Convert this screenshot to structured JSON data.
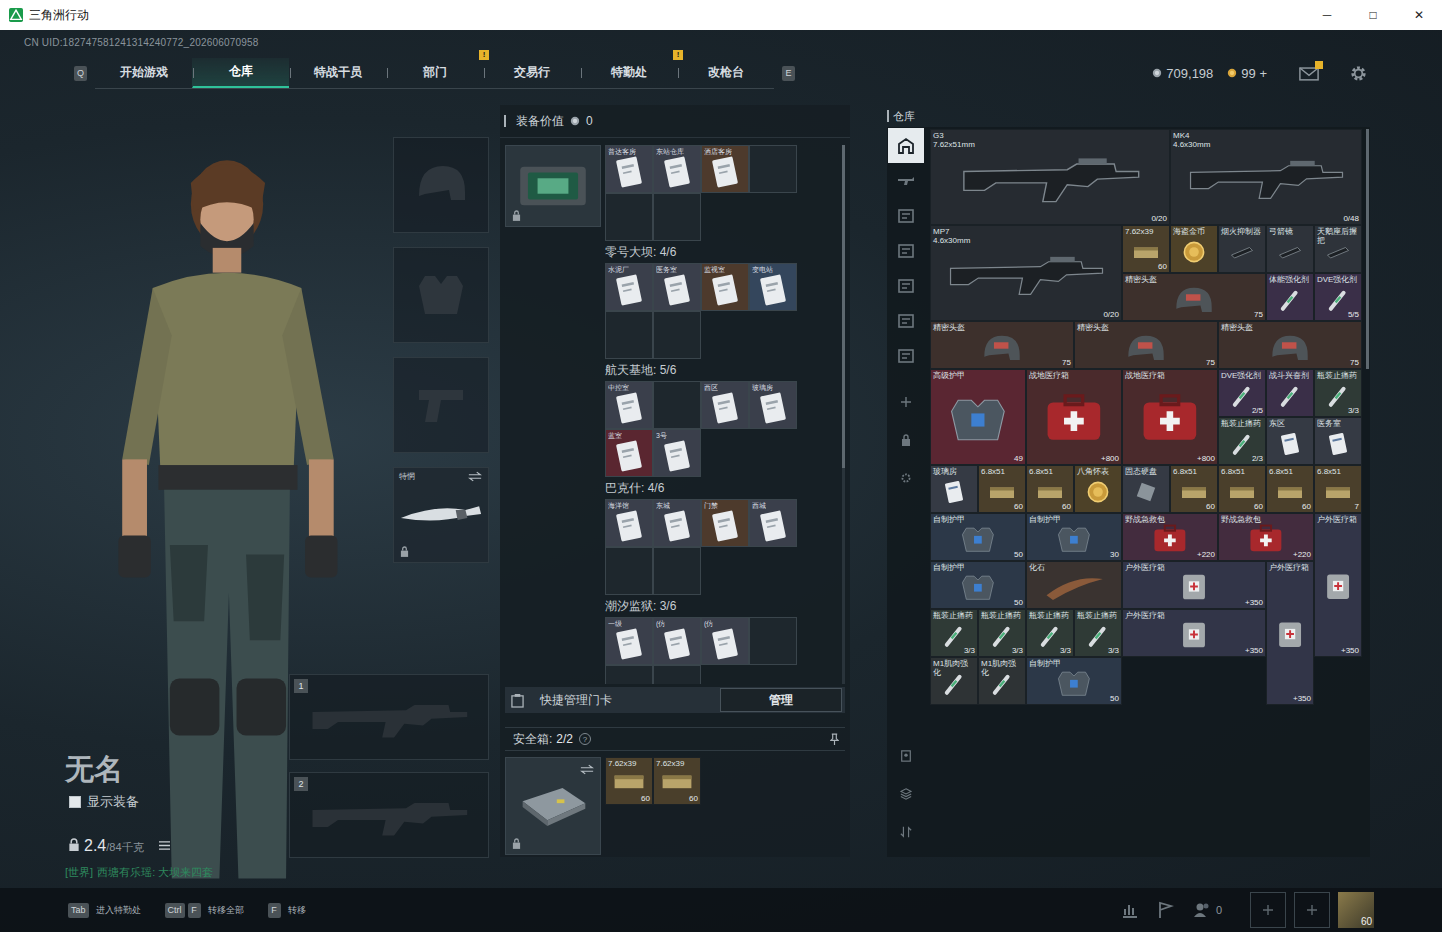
{
  "window": {
    "title": "三角洲行动",
    "controls": [
      "─",
      "□",
      "✕"
    ]
  },
  "uid": "CN UID:182747581241314240772_202606070958",
  "nav": {
    "prev_key": "Q",
    "next_key": "E",
    "alert_mark": "!",
    "tabs": [
      {
        "label": "开始游戏",
        "selected": false,
        "alert": false
      },
      {
        "label": "仓库",
        "selected": true,
        "alert": false
      },
      {
        "label": "特战干员",
        "selected": false,
        "alert": false
      },
      {
        "label": "部门",
        "selected": false,
        "alert": false
      },
      {
        "label": "交易行",
        "selected": false,
        "alert": true
      },
      {
        "label": "特勤处",
        "selected": false,
        "alert": false
      },
      {
        "label": "改枪台",
        "selected": false,
        "alert": true
      }
    ]
  },
  "currency": [
    {
      "kind": "silver",
      "amount": "709,198"
    },
    {
      "kind": "gold",
      "amount": "99 +"
    }
  ],
  "mail": {
    "alert": true
  },
  "character": {
    "name": "无名",
    "show_equipment": {
      "label": "显示装备",
      "checked": false
    },
    "weight": "2.4",
    "capacity": "/84千克",
    "chat": {
      "channel": "[世界]",
      "text": "西塘有乐瑶: 大坝来四套"
    }
  },
  "equipment": {
    "slots": [
      {
        "kind": "helmet",
        "filled": false
      },
      {
        "kind": "armor",
        "filled": false
      },
      {
        "kind": "pistol",
        "filled": false
      },
      {
        "kind": "knife",
        "filled": true,
        "label": "特惘",
        "locked": true
      }
    ],
    "weapons": [
      {
        "number": "1",
        "filled": false
      },
      {
        "number": "2",
        "filled": false
      }
    ]
  },
  "loadout": {
    "value_label": "装备价值",
    "value": "0",
    "keycards": {
      "locked": true,
      "groups": [
        {
          "slots": [
            {
              "filled": true,
              "label": "普达客房",
              "color": "#3a3f4b"
            },
            {
              "filled": true,
              "label": "东站仓库",
              "color": "#3a3f4b"
            },
            {
              "filled": true,
              "label": "酒店客房",
              "color": "#4d3a2c"
            },
            {
              "filled": false
            },
            {
              "filled": false
            },
            {
              "filled": false
            }
          ]
        },
        {
          "title": "零号大坝: 4/6",
          "slots": [
            {
              "filled": true,
              "label": "水泥厂",
              "color": "#3a3f4b"
            },
            {
              "filled": true,
              "label": "医务室",
              "color": "#3a3f4b"
            },
            {
              "filled": true,
              "label": "监视室",
              "color": "#4d3a2c"
            },
            {
              "filled": true,
              "label": "变电站",
              "color": "#34465c"
            },
            {
              "filled": false
            },
            {
              "filled": false
            }
          ]
        },
        {
          "title": "航天基地: 5/6",
          "slots": [
            {
              "filled": true,
              "label": "中控室",
              "color": "#3a3f4b"
            },
            {
              "filled": false
            },
            {
              "filled": true,
              "label": "西区",
              "color": "#3a3f4b"
            },
            {
              "filled": true,
              "label": "玻璃房",
              "color": "#3a3f4b"
            },
            {
              "filled": true,
              "label": "蓝室",
              "color": "#5a2630"
            },
            {
              "filled": true,
              "label": "3号",
              "color": "#3a3f4b"
            }
          ]
        },
        {
          "title": "巴克什: 4/6",
          "slots": [
            {
              "filled": true,
              "label": "海洋馆",
              "color": "#3a3f4b"
            },
            {
              "filled": true,
              "label": "东城",
              "color": "#3a3f4b"
            },
            {
              "filled": true,
              "label": "门禁",
              "color": "#4d3a2c"
            },
            {
              "filled": true,
              "label": "西城",
              "color": "#3a3f4b"
            },
            {
              "filled": false
            },
            {
              "filled": false
            }
          ]
        },
        {
          "title": "潮汐监狱: 3/6",
          "slots": [
            {
              "filled": true,
              "label": "一级",
              "color": "#3a3f4b"
            },
            {
              "filled": true,
              "label": "(仿",
              "color": "#3a3f4b"
            },
            {
              "filled": true,
              "label": "(仿",
              "color": "#3a3f4b"
            },
            {
              "filled": false
            },
            {
              "filled": false
            },
            {
              "filled": false
            }
          ]
        }
      ]
    },
    "quick_manage": {
      "label": "快捷管理门卡",
      "button": "管理"
    },
    "safebox": {
      "label": "安全箱:",
      "count": "2/2",
      "help": "?",
      "locked": true,
      "items": [
        {
          "name": "7.62x39",
          "count": "60"
        },
        {
          "name": "7.62x39",
          "count": "60"
        }
      ]
    }
  },
  "warehouse": {
    "title": "仓库",
    "sidebar": [
      {
        "kind": "all",
        "selected": true
      },
      {
        "kind": "rifle",
        "selected": false
      },
      {
        "kind": "box",
        "selected": false
      },
      {
        "kind": "box",
        "selected": false
      },
      {
        "kind": "box",
        "selected": false
      },
      {
        "kind": "box",
        "selected": false
      },
      {
        "kind": "box",
        "selected": false
      }
    ],
    "tools": [
      {
        "kind": "add"
      },
      {
        "kind": "lock"
      },
      {
        "kind": "gear"
      }
    ],
    "bottom_tools": [
      {
        "kind": "vendor"
      },
      {
        "kind": "layers"
      },
      {
        "kind": "sort"
      }
    ],
    "items": [
      {
        "kind": "weapon",
        "name": "G3",
        "sub": "7.62x51mm",
        "count": "0/20",
        "color": "#262b31"
      },
      {
        "kind": "weapon",
        "name": "MK4",
        "sub": "4.6x30mm",
        "count": "0/48",
        "color": "#262b31"
      },
      {
        "kind": "weapon",
        "name": "MP7",
        "sub": "4.6x30mm",
        "count": "0/20",
        "color": "#262b31"
      },
      {
        "kind": "ammo",
        "name": "7.62x39",
        "count": "60",
        "color": "#4a3f2b"
      },
      {
        "kind": "coin",
        "name": "海盗金币",
        "color": "#4d4128"
      },
      {
        "kind": "attach",
        "name": "烟火抑制器",
        "color": "#2e333a"
      },
      {
        "kind": "attach",
        "name": "弓箭镜",
        "color": "#2e333a"
      },
      {
        "kind": "attach",
        "name": "天鹅座后握把",
        "color": "#2e333a"
      },
      {
        "kind": "helmet",
        "name": "精密头盔",
        "count": "75",
        "color": "#3d302c"
      },
      {
        "kind": "vial",
        "name": "体能强化剂",
        "color": "#3a2f48"
      },
      {
        "kind": "vial",
        "name": "DVE强化剂",
        "count": "5/5",
        "color": "#3a2f48"
      },
      {
        "kind": "helmet",
        "name": "精密头盔",
        "count": "75",
        "color": "#3d302c"
      },
      {
        "kind": "helmet",
        "name": "精密头盔",
        "count": "75",
        "color": "#3d302c"
      },
      {
        "kind": "helmet",
        "name": "精密头盔",
        "count": "75",
        "color": "#3d302c"
      },
      {
        "kind": "armor",
        "name": "高级护甲",
        "count": "49",
        "color": "#5a2632"
      },
      {
        "kind": "medkit",
        "name": "战地医疗箱",
        "count": "+800",
        "color": "#4a2a2c"
      },
      {
        "kind": "medkit",
        "name": "战地医疗箱",
        "count": "+800",
        "color": "#4a2a2c"
      },
      {
        "kind": "vial",
        "name": "DVE强化剂",
        "count": "2/5",
        "color": "#3a2f48"
      },
      {
        "kind": "vial",
        "name": "战斗兴奋剂",
        "color": "#3a2f48"
      },
      {
        "kind": "vial",
        "name": "瓶装止痛药",
        "count": "3/3",
        "color": "#2f3a36"
      },
      {
        "kind": "vial",
        "name": "瓶装止痛药",
        "count": "2/3",
        "color": "#2f3a36"
      },
      {
        "kind": "card",
        "name": "东区",
        "color": "#353a44"
      },
      {
        "kind": "card",
        "name": "医务室",
        "color": "#353a44"
      },
      {
        "kind": "card",
        "name": "玻璃房",
        "color": "#353a44"
      },
      {
        "kind": "ammo",
        "name": "6.8x51",
        "count": "60",
        "color": "#4a3f2b"
      },
      {
        "kind": "ammo",
        "name": "6.8x51",
        "count": "60",
        "color": "#4a3f2b"
      },
      {
        "kind": "coin",
        "name": "八角怀表",
        "color": "#4d4128"
      },
      {
        "kind": "drive",
        "name": "固态硬盘",
        "color": "#353a44"
      },
      {
        "kind": "ammo",
        "name": "6.8x51",
        "count": "60",
        "color": "#4a3f2b"
      },
      {
        "kind": "ammo",
        "name": "6.8x51",
        "count": "60",
        "color": "#4a3f2b"
      },
      {
        "kind": "ammo",
        "name": "6.8x51",
        "count": "60",
        "color": "#4a3f2b"
      },
      {
        "kind": "ammo",
        "name": "6.8x51",
        "count": "7",
        "color": "#4a3f2b"
      },
      {
        "kind": "armor",
        "name": "自制护甲",
        "count": "50",
        "color": "#2c3848"
      },
      {
        "kind": "armor",
        "name": "自制护甲",
        "count": "30",
        "color": "#2c3848"
      },
      {
        "kind": "medkit",
        "name": "野战急救包",
        "count": "+220",
        "color": "#432c3e"
      },
      {
        "kind": "medkit",
        "name": "野战急救包",
        "count": "+220",
        "color": "#432c3e"
      },
      {
        "kind": "medbag",
        "name": "户外医疗箱",
        "count": "+350",
        "color": "#323548"
      },
      {
        "kind": "armor",
        "name": "自制护甲",
        "count": "50",
        "color": "#2c3848"
      },
      {
        "kind": "fossil",
        "name": "化石",
        "color": "#3a3330"
      },
      {
        "kind": "medbag",
        "name": "户外医疗箱",
        "count": "+350",
        "color": "#323548"
      },
      {
        "kind": "medbag",
        "name": "户外医疗箱",
        "count": "+350",
        "color": "#323548"
      },
      {
        "kind": "vial",
        "name": "瓶装止痛药",
        "count": "3/3",
        "color": "#2f3a36"
      },
      {
        "kind": "vial",
        "name": "瓶装止痛药",
        "count": "3/3",
        "color": "#2f3a36"
      },
      {
        "kind": "vial",
        "name": "瓶装止痛药",
        "count": "3/3",
        "color": "#2f3a36"
      },
      {
        "kind": "vial",
        "name": "瓶装止痛药",
        "count": "3/3",
        "color": "#2f3a36"
      },
      {
        "kind": "medbag",
        "name": "户外医疗箱",
        "count": "+350",
        "color": "#323548"
      },
      {
        "kind": "vial",
        "name": "M1肌肉强化",
        "color": "#2e3335"
      },
      {
        "kind": "vial",
        "name": "M1肌肉强化",
        "color": "#2e3335"
      },
      {
        "kind": "armor",
        "name": "自制护甲",
        "count": "50",
        "color": "#2c3848"
      }
    ]
  },
  "bottom_bar": {
    "hints": [
      {
        "keys": [
          "Tab"
        ],
        "label": "进入特勤处"
      },
      {
        "keys": [
          "Ctrl",
          "F"
        ],
        "label": "转移全部"
      },
      {
        "keys": [
          "F"
        ],
        "label": "转移"
      }
    ],
    "friends": "0",
    "level": "60"
  }
}
